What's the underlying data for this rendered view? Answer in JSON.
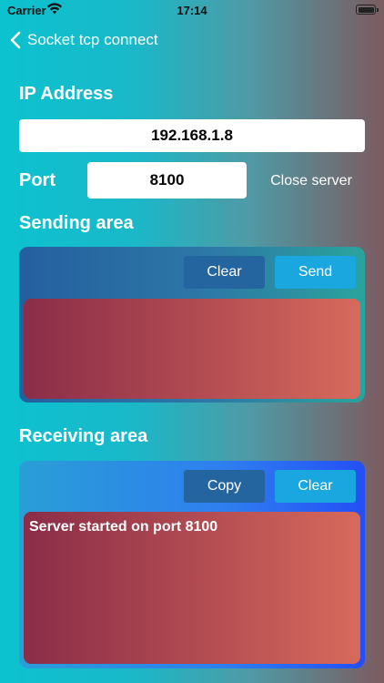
{
  "status_bar": {
    "carrier": "Carrier",
    "time": "17:14",
    "wifi_icon": "wifi-icon",
    "battery_icon": "battery-icon"
  },
  "nav": {
    "back_icon": "chevron-left-icon",
    "back_label": "Socket tcp connect"
  },
  "form": {
    "ip_label": "IP Address",
    "ip_value": "192.168.1.8",
    "port_label": "Port",
    "port_value": "8100",
    "close_server_label": "Close server"
  },
  "sending": {
    "title": "Sending area",
    "clear_label": "Clear",
    "send_label": "Send",
    "text": ""
  },
  "receiving": {
    "title": "Receiving area",
    "copy_label": "Copy",
    "clear_label": "Clear",
    "text": "Server started on port 8100"
  },
  "colors": {
    "bg_left": "#0cc2cf",
    "bg_right": "#7b5b60",
    "button_dark": "#2465a0",
    "button_light": "#1aa6df",
    "text_area": "#b44d53"
  }
}
